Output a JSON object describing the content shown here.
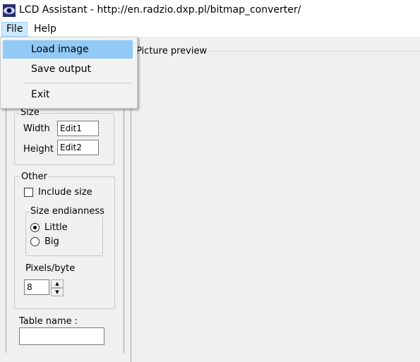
{
  "window": {
    "title": "LCD Assistant -  http://en.radzio.dxp.pl/bitmap_converter/",
    "app_icon": "eye-icon"
  },
  "menubar": {
    "file_label": "File",
    "help_label": "Help"
  },
  "file_menu": {
    "items": [
      {
        "label": "Load image"
      },
      {
        "label": "Save output"
      },
      {
        "label": "Exit"
      }
    ]
  },
  "size_group": {
    "legend": "Size",
    "width_label": "Width",
    "width_value": "Edit1",
    "height_label": "Height",
    "height_value": "Edit2"
  },
  "other_group": {
    "legend": "Other",
    "include_size_label": "Include size",
    "include_size_checked": false,
    "endianness": {
      "legend": "Size endianness",
      "little_label": "Little",
      "big_label": "Big",
      "selected": "Little"
    },
    "pixels_per_byte_label": "Pixels/byte",
    "pixels_per_byte_value": "8"
  },
  "table_name": {
    "label": "Table name :",
    "value": ""
  },
  "preview": {
    "legend": "Picture preview"
  },
  "colors": {
    "menu_highlight": "#91c9f7",
    "menubar_active": "#cce8ff",
    "background": "#f0f0f0"
  }
}
